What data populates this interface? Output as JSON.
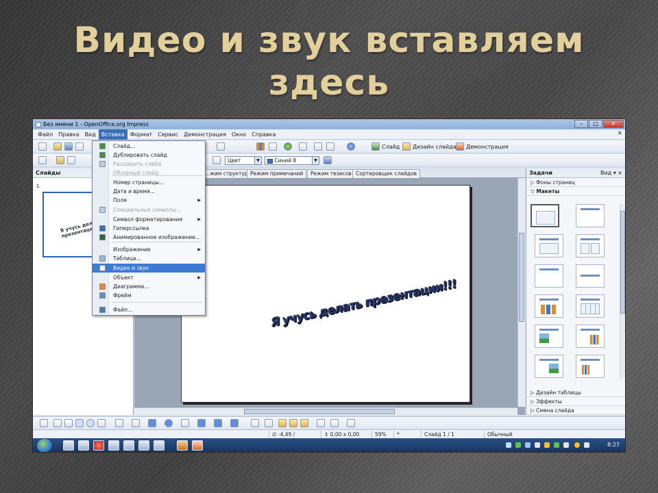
{
  "slide_title": "Видео и звук вставляем здесь",
  "window": {
    "title": "Без имени 1 - OpenOffice.org Impress"
  },
  "menubar": {
    "items": [
      "Файл",
      "Правка",
      "Вид",
      "Вставка",
      "Формат",
      "Сервис",
      "Демонстрация",
      "Окно",
      "Справка"
    ],
    "active": "Вставка"
  },
  "toolbar": {
    "slide_label": "Слайд",
    "design_label": "Дизайн слайда",
    "show_label": "Демонстрация",
    "color_mode": "Цвет",
    "line_color": "Синий 8"
  },
  "slides_pane": {
    "title": "Слайды",
    "thumb_number": "1"
  },
  "view_tabs": [
    "...жим структуры",
    "Режим примечаний",
    "Режим тезисов",
    "Сортировщик слайдов"
  ],
  "insert_menu": [
    {
      "label": "Слайд...",
      "icon": "new-slide-icon",
      "color": "#4a8f3e",
      "disabled": false
    },
    {
      "label": "Дублировать слайд",
      "icon": "duplicate-slide-icon",
      "color": "#4a8f3e",
      "disabled": false
    },
    {
      "label": "Расширить слайд",
      "icon": "expand-slide-icon",
      "color": "#c6ccd6",
      "disabled": true
    },
    {
      "label": "Обзорный слайд",
      "icon": "",
      "disabled": true
    },
    {
      "label": "Номер страницы...",
      "icon": "",
      "disabled": false
    },
    {
      "label": "Дата и время...",
      "icon": "",
      "disabled": false
    },
    {
      "label": "Поля",
      "icon": "",
      "disabled": false,
      "submenu": true
    },
    {
      "label": "Специальные символы...",
      "icon": "special-char-icon",
      "color": "#c6ccd6",
      "disabled": true
    },
    {
      "label": "Символ форматирования",
      "icon": "",
      "disabled": false,
      "submenu": true
    },
    {
      "label": "Гиперссылка",
      "icon": "hyperlink-icon",
      "color": "#3a6fb8",
      "disabled": false
    },
    {
      "label": "Анимированное изображение...",
      "icon": "animated-image-icon",
      "color": "#2a6a3a",
      "disabled": false
    },
    {
      "label": "Изображение",
      "icon": "",
      "disabled": false,
      "submenu": true
    },
    {
      "label": "Таблица...",
      "icon": "table-icon",
      "color": "#9fb4d6",
      "disabled": false
    },
    {
      "label": "Видео и звук",
      "icon": "video-sound-icon",
      "color": "#f0f4fa",
      "disabled": false,
      "highlighted": true
    },
    {
      "label": "Объект",
      "icon": "",
      "disabled": false,
      "submenu": true
    },
    {
      "label": "Диаграмма...",
      "icon": "chart-icon",
      "color": "#e48a2a",
      "disabled": false
    },
    {
      "label": "Фрейм",
      "icon": "frame-icon",
      "color": "#6b8fc2",
      "disabled": false
    },
    {
      "label": "Файл...",
      "icon": "file-icon",
      "color": "#4a7db0",
      "disabled": false
    }
  ],
  "canvas": {
    "wordart": "Я учусь делать презентации!!!"
  },
  "task_pane": {
    "title": "Задачи",
    "view_label": "Вид",
    "sections_top": [
      "Фоны страниц",
      "Макеты"
    ],
    "sections_bottom": [
      "Дизайн таблицы",
      "Эффекты",
      "Смена слайда"
    ]
  },
  "status": {
    "position": "-4,49 / 8,61",
    "size": "0,00 x 0,00",
    "zoom": "59%",
    "modified": "*",
    "slide": "Слайд 1 / 1",
    "layout": "Обычный"
  },
  "taskbar": {
    "clock": "8:27"
  },
  "colors": {
    "title": "#e2cf9a",
    "menu_highlight": "#3d7ad6",
    "taskbar": "#17335e"
  }
}
